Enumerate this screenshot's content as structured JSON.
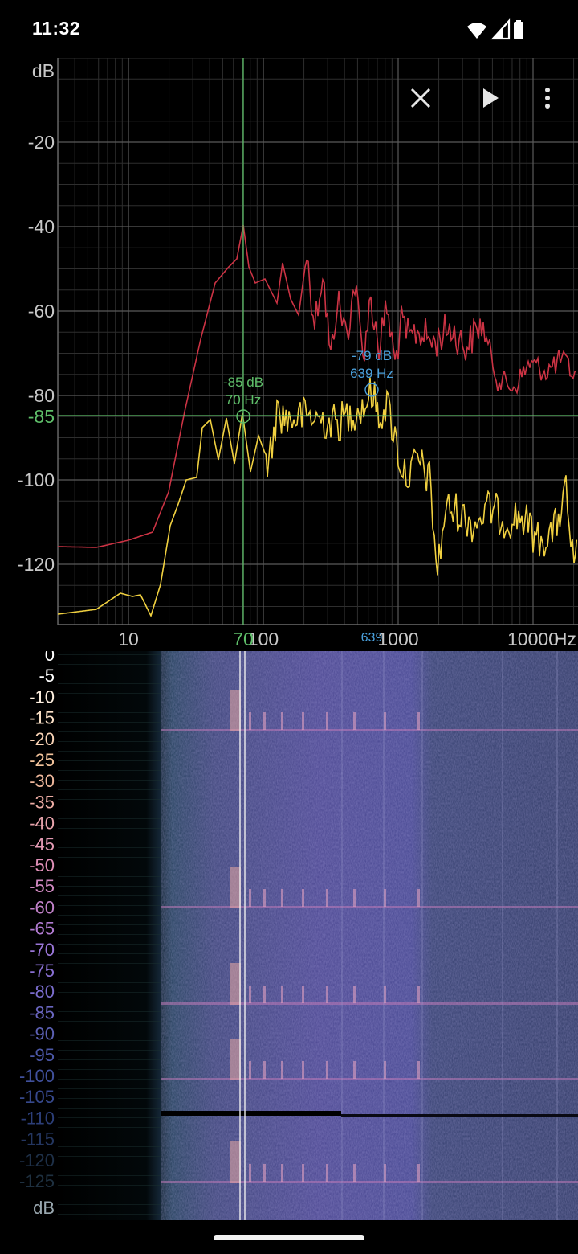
{
  "status_bar": {
    "time": "11:32"
  },
  "toolbar": {
    "icons": [
      "close-icon",
      "play-icon",
      "more-vert-icon"
    ]
  },
  "spectrum": {
    "y_axis_unit": "dB",
    "y_ticks": [
      "-20",
      "-40",
      "-60",
      "-80",
      "-100",
      "-120"
    ],
    "y_highlight": "-85",
    "x_ticks": [
      "10",
      "100",
      "1000",
      "10000"
    ],
    "x_unit": "Hz",
    "cursor_freq_label": "70",
    "colors": {
      "grid": "#5a5a5a",
      "red_series": "#cc3344",
      "yellow_series": "#f0d040",
      "cursor": "#5fbf6a",
      "peak": "#4aa0dc"
    },
    "cursor_marker": {
      "db_label": "-85 dB",
      "hz_label": "70 Hz"
    },
    "peak_marker": {
      "db_label": "-79 dB",
      "hz_label": "639 Hz",
      "axis_label": "639"
    }
  },
  "spectrogram": {
    "scale_labels": [
      "0",
      "-5",
      "-10",
      "-15",
      "-20",
      "-25",
      "-30",
      "-35",
      "-40",
      "-45",
      "-50",
      "-55",
      "-60",
      "-65",
      "-70",
      "-75",
      "-80",
      "-85",
      "-90",
      "-95",
      "-100",
      "-105",
      "-110",
      "-115",
      "-120",
      "-125"
    ],
    "scale_unit": "dB"
  }
}
